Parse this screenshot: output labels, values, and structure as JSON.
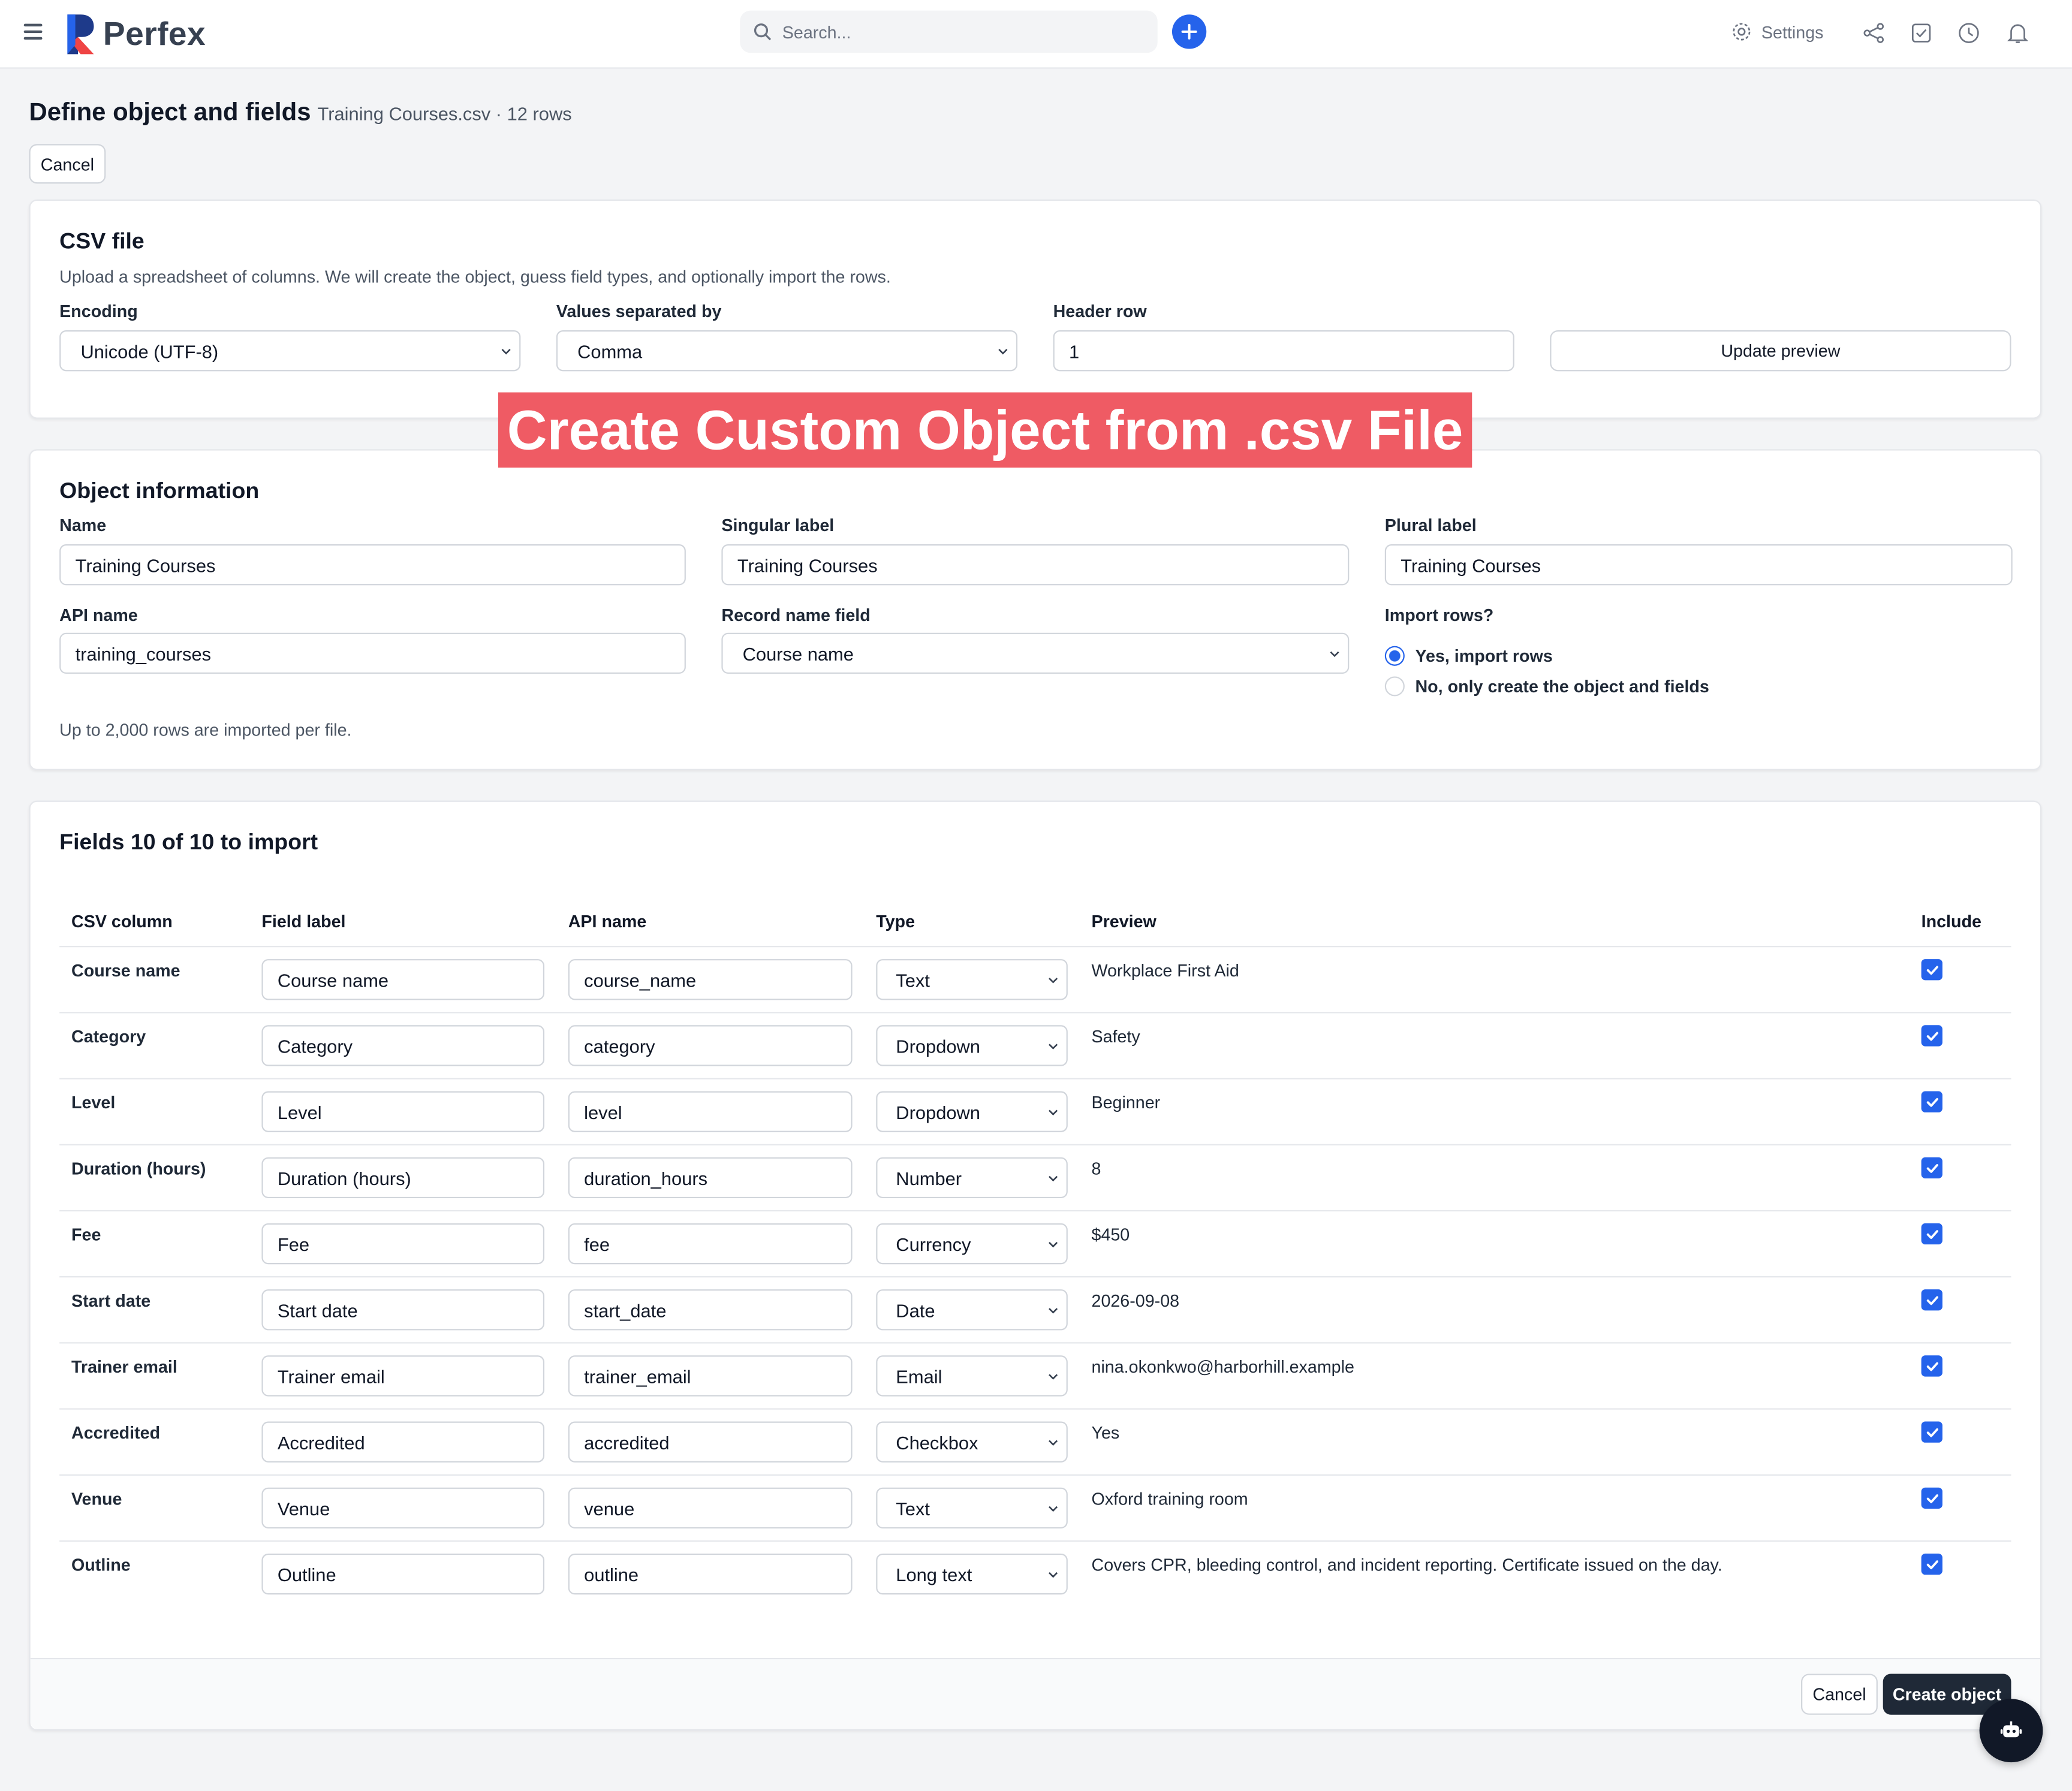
{
  "app": {
    "logo_text": "Perfex",
    "search_placeholder": "Search...",
    "settings_label": "Settings",
    "accent_color": "#2563eb",
    "icons": [
      "menu-icon",
      "search-icon",
      "plus-icon",
      "gear-icon",
      "share-icon",
      "checkbox-square-icon",
      "clock-icon",
      "bell-icon",
      "robot-icon"
    ]
  },
  "header": {
    "title": "Define object and fields",
    "subtitle": "Training Courses.csv · 12 rows",
    "cancel_label": "Cancel"
  },
  "banner": {
    "text": "Create Custom Object from .csv File",
    "color": "#ef5b64"
  },
  "csv_file": {
    "title": "CSV file",
    "description": "Upload a spreadsheet of columns. We will create the object, guess field types, and optionally import the rows.",
    "encoding_label": "Encoding",
    "encoding_value": "Unicode (UTF-8)",
    "separator_label": "Values separated by",
    "separator_value": "Comma",
    "header_row_label": "Header row",
    "header_row_value": "1",
    "update_preview_label": "Update preview"
  },
  "object_info": {
    "title": "Object information",
    "name_label": "Name",
    "name_value": "Training Courses",
    "singular_label": "Singular label",
    "singular_value": "Training Courses",
    "plural_label": "Plural label",
    "plural_value": "Training Courses",
    "api_name_label": "API name",
    "api_name_value": "training_courses",
    "record_name_label": "Record name field",
    "record_name_value": "Course name",
    "import_rows_label": "Import rows?",
    "import_yes": "Yes, import rows",
    "import_no": "No, only create the object and fields",
    "import_selected": "yes",
    "note": "Up to 2,000 rows are imported per file."
  },
  "fields": {
    "title": "Fields 10 of 10 to import",
    "headers": {
      "csv_column": "CSV column",
      "field_label": "Field label",
      "api_name": "API name",
      "type": "Type",
      "preview": "Preview",
      "include": "Include"
    },
    "rows": [
      {
        "csv": "Course name",
        "label": "Course name",
        "api": "course_name",
        "type": "Text",
        "preview": "Workplace First Aid",
        "include": true
      },
      {
        "csv": "Category",
        "label": "Category",
        "api": "category",
        "type": "Dropdown",
        "preview": "Safety",
        "include": true
      },
      {
        "csv": "Level",
        "label": "Level",
        "api": "level",
        "type": "Dropdown",
        "preview": "Beginner",
        "include": true
      },
      {
        "csv": "Duration (hours)",
        "label": "Duration (hours)",
        "api": "duration_hours",
        "type": "Number",
        "preview": "8",
        "include": true
      },
      {
        "csv": "Fee",
        "label": "Fee",
        "api": "fee",
        "type": "Currency",
        "preview": "$450",
        "include": true
      },
      {
        "csv": "Start date",
        "label": "Start date",
        "api": "start_date",
        "type": "Date",
        "preview": "2026-09-08",
        "include": true
      },
      {
        "csv": "Trainer email",
        "label": "Trainer email",
        "api": "trainer_email",
        "type": "Email",
        "preview": "nina.okonkwo@harborhill.example",
        "include": true
      },
      {
        "csv": "Accredited",
        "label": "Accredited",
        "api": "accredited",
        "type": "Checkbox",
        "preview": "Yes",
        "include": true
      },
      {
        "csv": "Venue",
        "label": "Venue",
        "api": "venue",
        "type": "Text",
        "preview": "Oxford training room",
        "include": true
      },
      {
        "csv": "Outline",
        "label": "Outline",
        "api": "outline",
        "type": "Long text",
        "preview": "Covers CPR, bleeding control, and incident reporting. Certificate issued on the day.",
        "include": true
      }
    ]
  },
  "footer": {
    "cancel_label": "Cancel",
    "create_label": "Create object"
  }
}
